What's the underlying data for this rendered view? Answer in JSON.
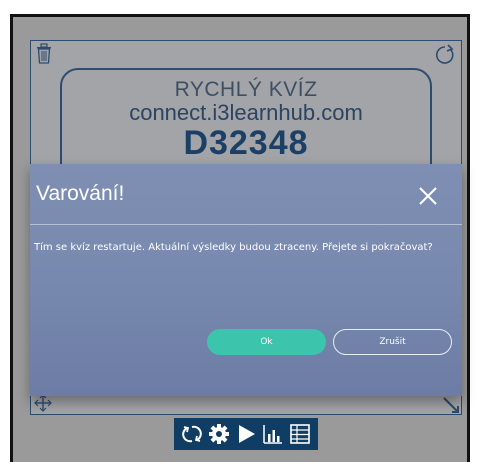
{
  "quiz": {
    "title": "RYCHLÝ KVÍZ",
    "url": "connect.i3learnhub.com",
    "code": "D32348"
  },
  "dialog": {
    "title": "Varování!",
    "message": "Tím se kvíz restartuje. Aktuální výsledky budou ztraceny. Přejete si pokračovat?",
    "ok_label": "Ok",
    "cancel_label": "Zrušit"
  },
  "toolbar": {
    "icons": [
      "refresh-icon",
      "gear-icon",
      "play-icon",
      "bar-chart-icon",
      "table-icon"
    ]
  },
  "colors": {
    "dialog_bg": "#7788ae",
    "ok_button": "#3cc4ac",
    "toolbar_bg": "#0f3d63",
    "border": "#2e4c6f"
  }
}
